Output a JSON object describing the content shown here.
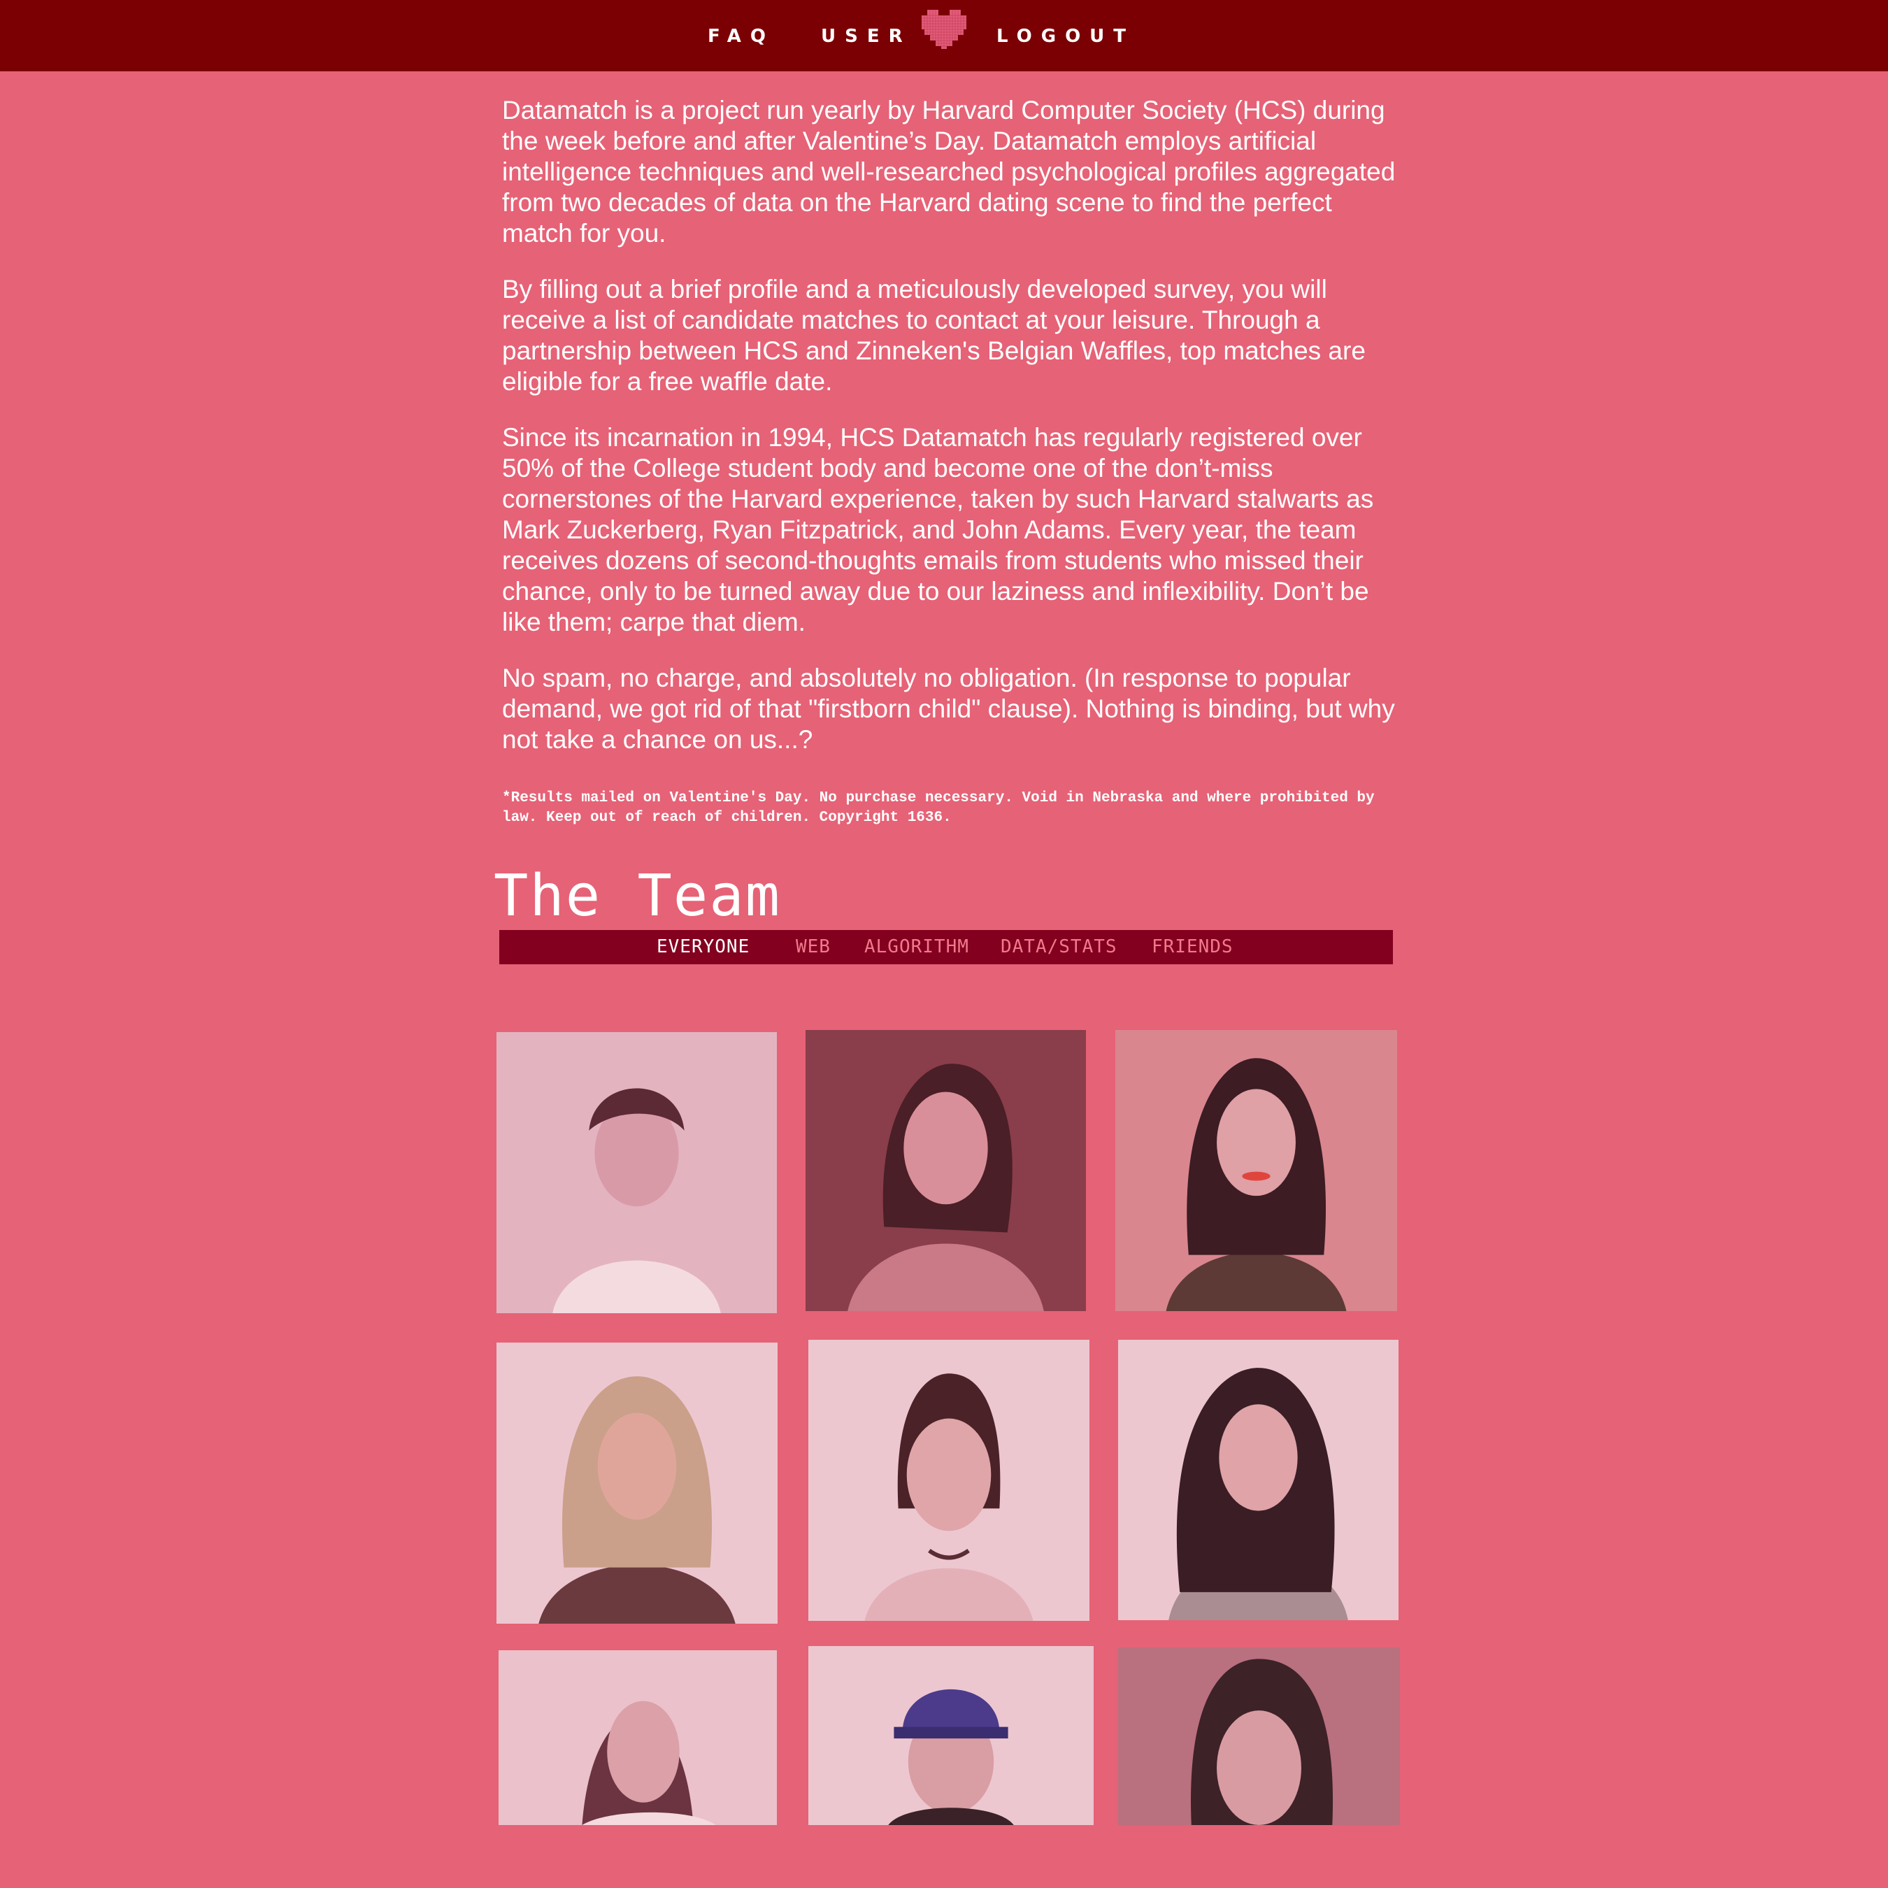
{
  "nav": {
    "faq": "FAQ",
    "user": "USER",
    "logout": "LOGOUT",
    "logo_icon": "pixel-heart-icon"
  },
  "intro": {
    "p1": "Datamatch is a project run yearly by Harvard Computer Society (HCS) during the week before and after Valentine’s Day. Datamatch employs artificial intelligence techniques and well-researched psychological profiles aggregated from two decades of data on the Harvard dating scene to find the perfect match for you.",
    "p2": "By filling out a brief profile and a meticulously developed survey, you will receive a list of candidate matches to contact at your leisure. Through a partnership between HCS and Zinneken's Belgian Waffles, top matches are eligible for a free waffle date.",
    "p3": "Since its incarnation in 1994, HCS Datamatch has regularly registered over 50% of the College student body and become one of the don’t-miss cornerstones of the Harvard experience, taken by such Harvard stalwarts as Mark Zuckerberg, Ryan Fitzpatrick, and John Adams. Every year, the team receives dozens of second-thoughts emails from students who missed their chance, only to be turned away due to our laziness and inflexibility. Don’t be like them; carpe that diem.",
    "p4": "No spam, no charge, and absolutely no obligation. (In response to popular demand, we got rid of that \"firstborn child\" clause). Nothing is binding, but why not take a chance on us...?",
    "fineprint": "*Results mailed on Valentine's Day. No purchase necessary. Void in Nebraska and where prohibited by law. Keep out of reach of children. Copyright 1636."
  },
  "team": {
    "title": "The Team",
    "tabs": [
      "EVERYONE",
      "WEB",
      "ALGORITHM",
      "DATA/STATS",
      "FRIENDS"
    ],
    "active_tab": "EVERYONE"
  },
  "colors": {
    "page_bg": "#e66276",
    "nav_bg": "#7b0004",
    "tab_bar_bg": "#83001f",
    "tab_inactive": "#f07a8c",
    "heart": "#e35a7a"
  }
}
